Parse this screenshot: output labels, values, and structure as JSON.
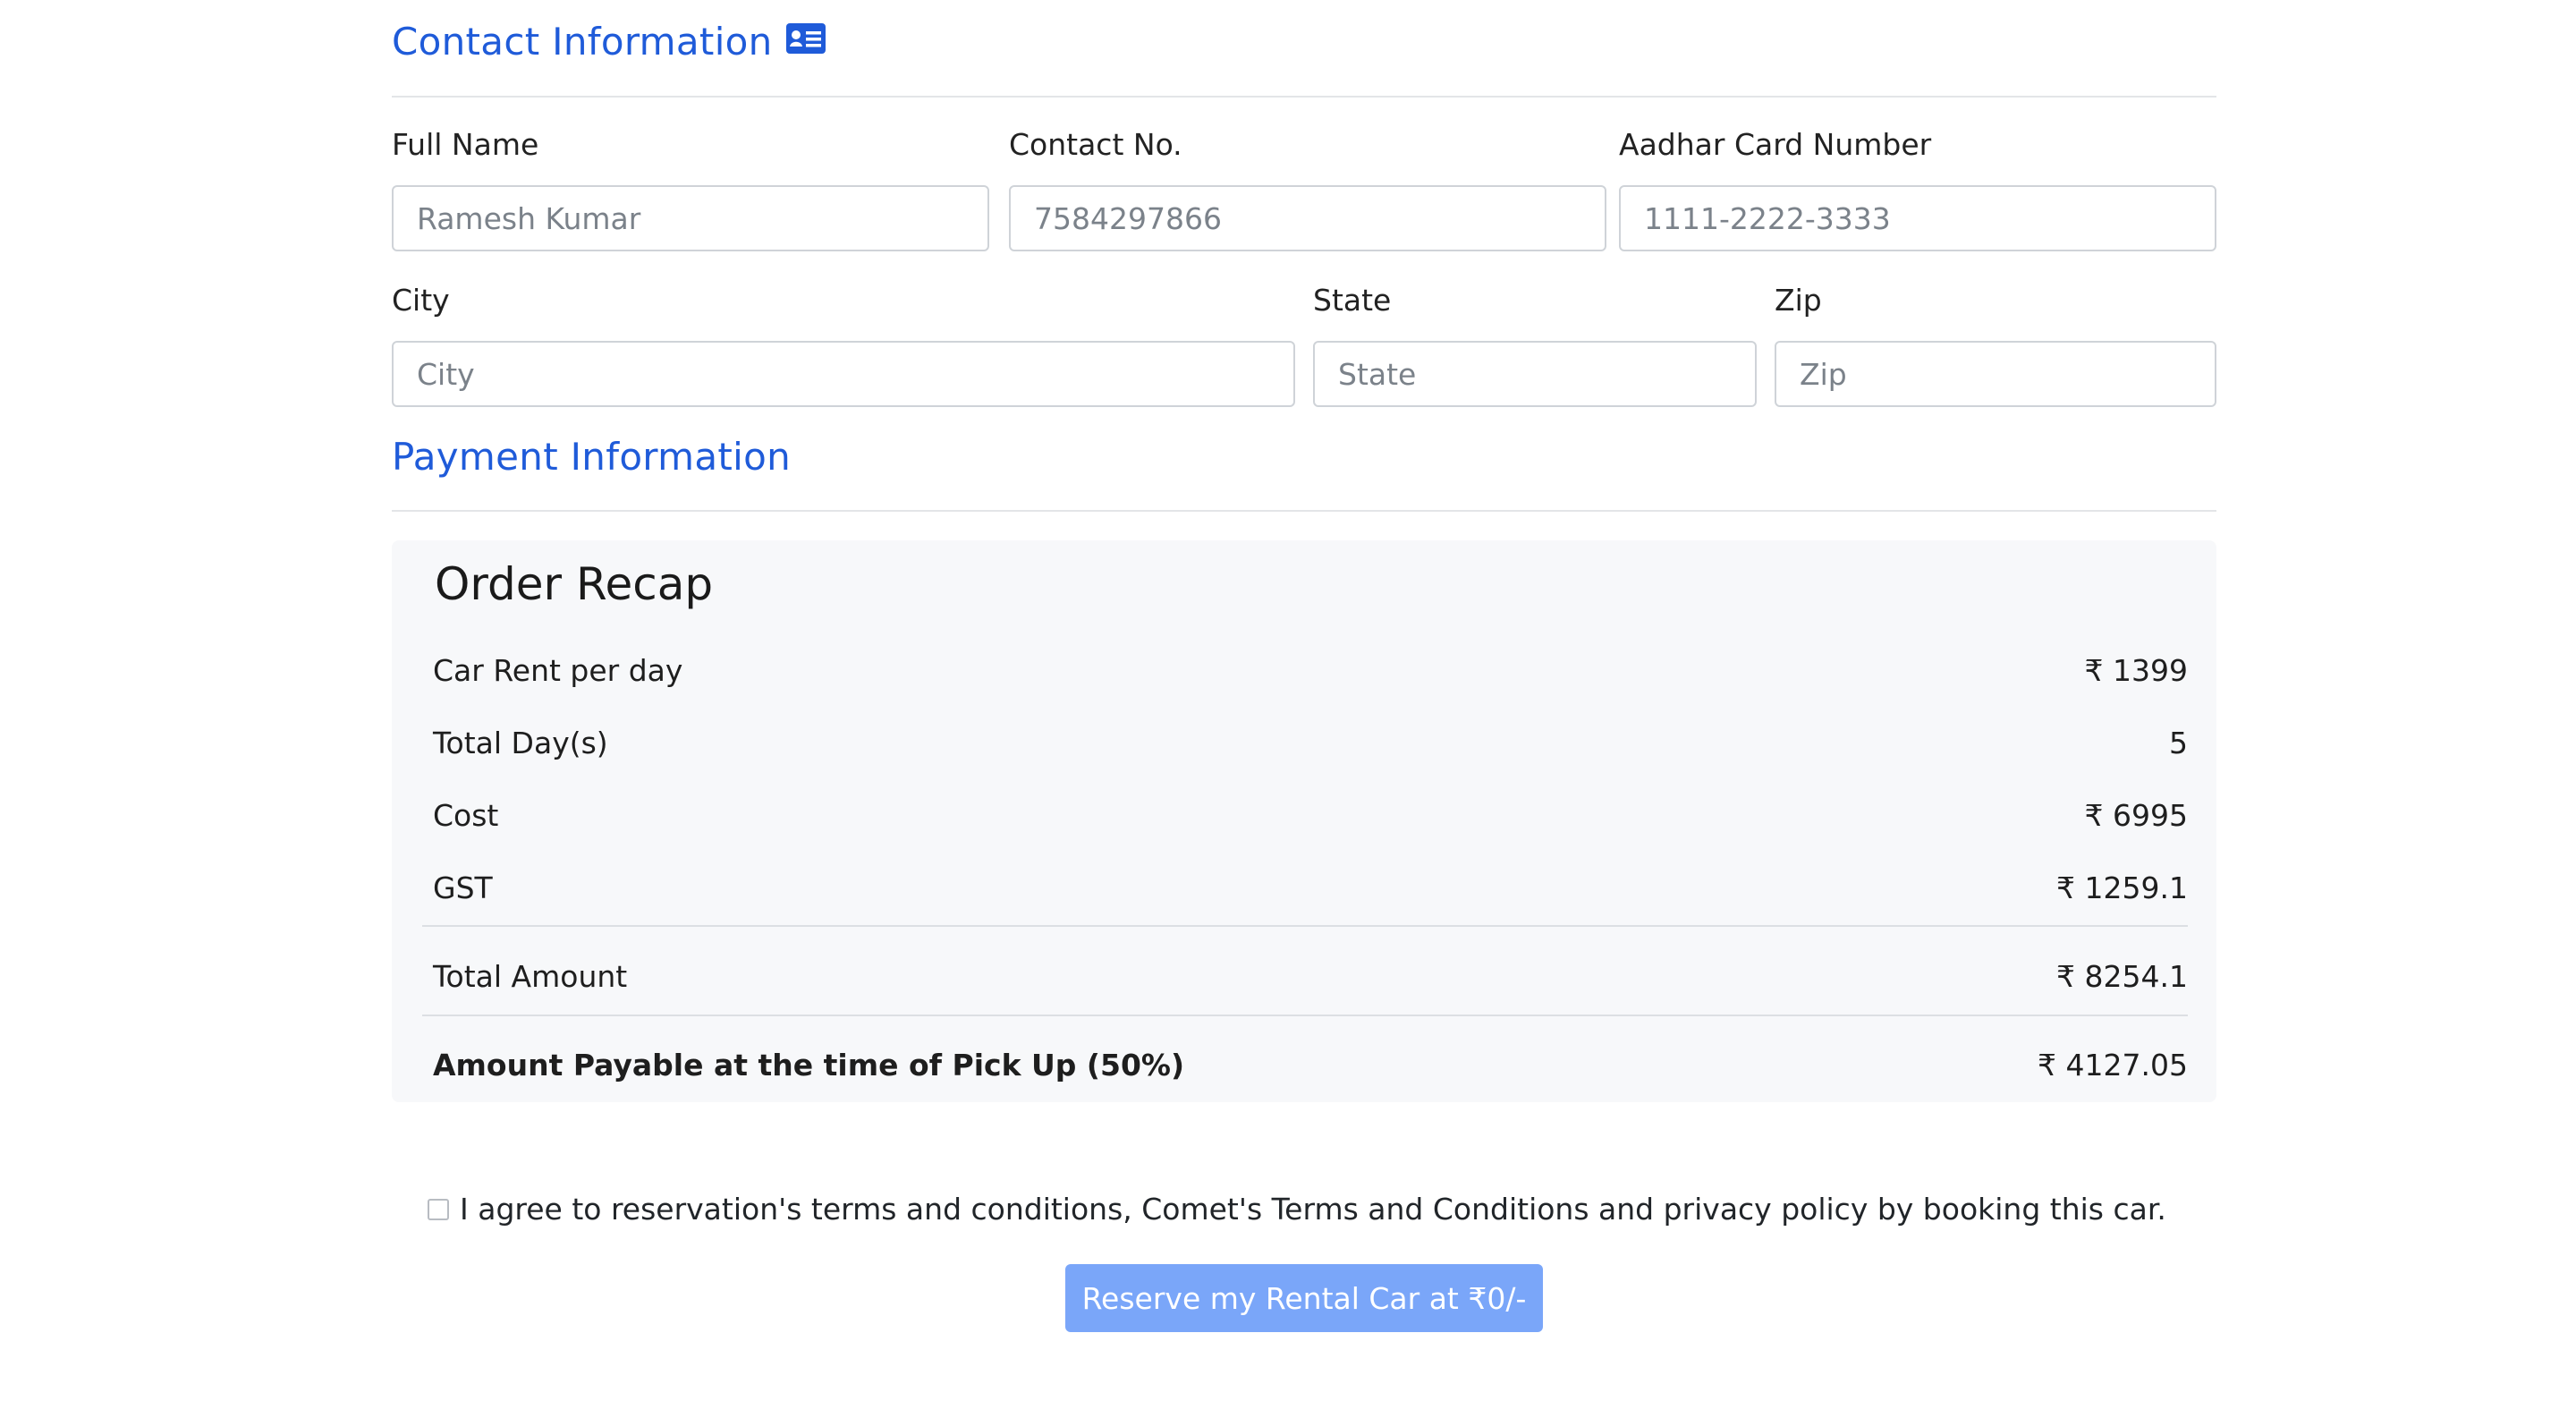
{
  "contact": {
    "title": "Contact Information",
    "icon": "id-card-icon",
    "fields": {
      "full_name": {
        "label": "Full Name",
        "placeholder": "Ramesh Kumar"
      },
      "contact_no": {
        "label": "Contact No.",
        "placeholder": "7584297866"
      },
      "aadhar": {
        "label": "Aadhar Card Number",
        "placeholder": "1111-2222-3333"
      },
      "city": {
        "label": "City",
        "placeholder": "City"
      },
      "state": {
        "label": "State",
        "placeholder": "State"
      },
      "zip": {
        "label": "Zip",
        "placeholder": "Zip"
      }
    }
  },
  "payment": {
    "title": "Payment Information"
  },
  "recap": {
    "title": "Order Recap",
    "rows": [
      {
        "label": "Car Rent per day",
        "value": "₹ 1399"
      },
      {
        "label": "Total Day(s)",
        "value": "5"
      },
      {
        "label": "Cost",
        "value": "₹ 6995"
      },
      {
        "label": "GST",
        "value": "₹ 1259.1"
      },
      {
        "label": "Total Amount",
        "value": "₹ 8254.1"
      },
      {
        "label": "Amount Payable at the time of Pick Up (50%)",
        "value": "₹ 4127.05"
      }
    ]
  },
  "agreement": {
    "text": "I agree to reservation's terms and conditions, Comet's Terms and Conditions and privacy policy by booking this car.",
    "checked": false
  },
  "reserve_button": {
    "label": "Reserve my Rental Car at ₹0/-"
  },
  "colors": {
    "heading": "#1f5bd9",
    "button": "#7aa6f9",
    "recap_bg": "#f7f8fa"
  }
}
